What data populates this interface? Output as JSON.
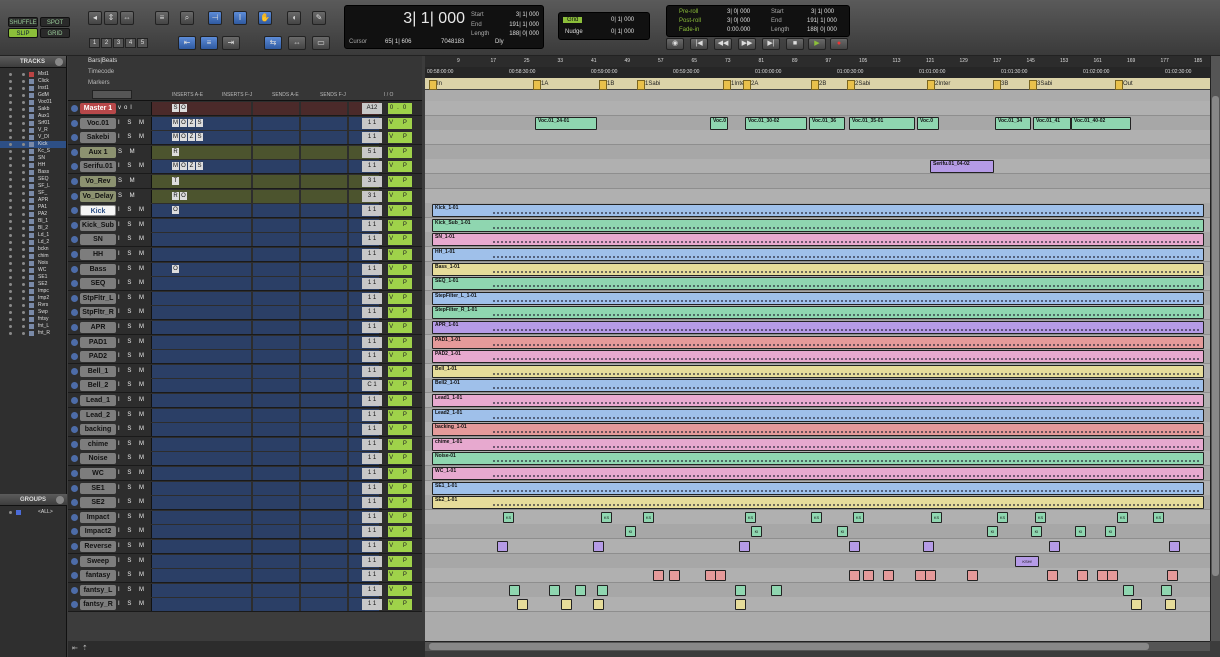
{
  "toolbar": {
    "modes": [
      "SHUFFLE",
      "SPOT",
      "SLIP",
      "GRID"
    ],
    "zoom_presets": [
      "1",
      "2",
      "3",
      "4",
      "5"
    ],
    "counter": {
      "main": "3| 1| 000",
      "cursor_label": "Cursor",
      "cursor_value": "65| 1| 606",
      "samples": "7048183",
      "start_label": "Start",
      "start_value": "3| 1| 000",
      "end_label": "End",
      "end_value": "191| 1| 000",
      "length_label": "Length",
      "length_value": "188| 0| 000",
      "dly_label": "Dly"
    },
    "grid": {
      "label": "Grid",
      "value": "0| 1| 000",
      "nudge_label": "Nudge",
      "nudge_value": "0| 1| 000"
    },
    "preroll": {
      "pre_label": "Pre-roll",
      "pre_value": "3| 0| 000",
      "post_label": "Post-roll",
      "post_value": "3| 0| 000",
      "fade_label": "Fade-in",
      "fade_value": "0:00.000",
      "start_label": "Start",
      "start_value": "3| 1| 000",
      "end_label": "End",
      "end_value": "191| 1| 000",
      "length_label": "Length",
      "length_value": "188| 0| 000"
    },
    "transport": [
      "◉",
      "|◀",
      "◀◀",
      "▶▶",
      "▶|",
      "■",
      "▶",
      "●"
    ]
  },
  "tracks_panel": {
    "title": "TRACKS",
    "items": [
      "Mst1",
      "Click",
      "Inst1",
      "GdM",
      "Voc01",
      "Sakb",
      "Aux1",
      "Srf01",
      "V_R",
      "V_Dl",
      "Kick",
      "Kc_S",
      "SN",
      "HH",
      "Bass",
      "SEQ",
      "SF_L",
      "SF_",
      "APR",
      "PA1",
      "PA2",
      "Bl_1",
      "Bl_2",
      "Ld_1",
      "Ld_2",
      "bckn",
      "chim",
      "Nois",
      "WC",
      "SE1",
      "SE2",
      "Impc",
      "Imp2",
      "Rvrs",
      "Swp",
      "fntsy",
      "fnt_L",
      "fnt_R"
    ],
    "selected": "Kick"
  },
  "groups_panel": {
    "title": "GROUPS",
    "items": [
      "<ALL>"
    ]
  },
  "mix_columns": [
    "INSERTS A-E",
    "INSERTS F-J",
    "SENDS A-E",
    "SENDS F-J",
    "I / O"
  ],
  "tracks": [
    {
      "name": "Master 1",
      "style": "red",
      "ism": "vol",
      "io": "A12",
      "vp": "0.0",
      "slots": [
        "S",
        "O"
      ]
    },
    {
      "name": "Voc.01",
      "ism": "I S M",
      "io": "1 1",
      "vp": "V P",
      "slots": [
        "M",
        "O",
        "Z",
        "S"
      ]
    },
    {
      "name": "Sakebi",
      "ism": "I S M",
      "io": "1 1",
      "vp": "V P",
      "slots": [
        "M",
        "O",
        "Z",
        "S"
      ]
    },
    {
      "name": "Aux 1",
      "style": "olive",
      "ism": "S M",
      "io": "5 1",
      "vp": "V P",
      "slots": [
        "R"
      ]
    },
    {
      "name": "Serifu.01",
      "ism": "I S M",
      "io": "1 1",
      "vp": "V P",
      "slots": [
        "M",
        "O",
        "Z",
        "S"
      ]
    },
    {
      "name": "Vo_Rev",
      "style": "olive",
      "ism": "S M",
      "io": "3 1",
      "vp": "V P",
      "slots": [
        "T"
      ]
    },
    {
      "name": "Vo_Delay",
      "style": "olive",
      "ism": "S M",
      "io": "3 1",
      "vp": "V P",
      "slots": [
        "R",
        "O"
      ]
    },
    {
      "name": "Kick",
      "style": "white",
      "ism": "I S M",
      "io": "1 1",
      "vp": "V P",
      "slots": [
        "O"
      ]
    },
    {
      "name": "Kick_Sub",
      "ism": "I S M",
      "io": "1 1",
      "vp": "V P",
      "slots": []
    },
    {
      "name": "SN",
      "ism": "I S M",
      "io": "1 1",
      "vp": "V P",
      "slots": []
    },
    {
      "name": "HH",
      "ism": "I S M",
      "io": "1 1",
      "vp": "V P",
      "slots": []
    },
    {
      "name": "Bass",
      "ism": "I S M",
      "io": "1 1",
      "vp": "V P",
      "slots": [
        "O"
      ]
    },
    {
      "name": "SEQ",
      "ism": "I S M",
      "io": "1 1",
      "vp": "V P",
      "slots": []
    },
    {
      "name": "StpFltr_L",
      "ism": "I S M",
      "io": "1 1",
      "vp": "V P",
      "slots": []
    },
    {
      "name": "StpFltr_R",
      "ism": "I S M",
      "io": "1 1",
      "vp": "V P",
      "slots": []
    },
    {
      "name": "APR",
      "ism": "I S M",
      "io": "1 1",
      "vp": "V P",
      "slots": []
    },
    {
      "name": "PAD1",
      "ism": "I S M",
      "io": "1 1",
      "vp": "V P",
      "slots": []
    },
    {
      "name": "PAD2",
      "ism": "I S M",
      "io": "1 1",
      "vp": "V P",
      "slots": []
    },
    {
      "name": "Bell_1",
      "ism": "I S M",
      "io": "1 1",
      "vp": "V P",
      "slots": []
    },
    {
      "name": "Bell_2",
      "ism": "I S M",
      "io": "C 1",
      "vp": "V P",
      "slots": []
    },
    {
      "name": "Lead_1",
      "ism": "I S M",
      "io": "1 1",
      "vp": "V P",
      "slots": []
    },
    {
      "name": "Lead_2",
      "ism": "I S M",
      "io": "1 1",
      "vp": "V P",
      "slots": []
    },
    {
      "name": "backing",
      "ism": "I S M",
      "io": "1 1",
      "vp": "V P",
      "slots": []
    },
    {
      "name": "chime",
      "ism": "I S M",
      "io": "1 1",
      "vp": "V P",
      "slots": []
    },
    {
      "name": "Noise",
      "ism": "I S M",
      "io": "1 1",
      "vp": "V P",
      "slots": []
    },
    {
      "name": "WC",
      "ism": "I S M",
      "io": "1 1",
      "vp": "V P",
      "slots": []
    },
    {
      "name": "SE1",
      "ism": "I S M",
      "io": "1 1",
      "vp": "V P",
      "slots": []
    },
    {
      "name": "SE2",
      "ism": "I S M",
      "io": "1 1",
      "vp": "V P",
      "slots": []
    },
    {
      "name": "Impact",
      "ism": "I S M",
      "io": "1 1",
      "vp": "V P",
      "slots": []
    },
    {
      "name": "Impact2",
      "ism": "I S M",
      "io": "1 1",
      "vp": "V P",
      "slots": []
    },
    {
      "name": "Reverse",
      "ism": "I S M",
      "io": "1 1",
      "vp": "V P",
      "slots": []
    },
    {
      "name": "Sweep",
      "ism": "I S M",
      "io": "1 1",
      "vp": "V P",
      "slots": []
    },
    {
      "name": "fantasy",
      "ism": "I S M",
      "io": "1 1",
      "vp": "V P",
      "slots": []
    },
    {
      "name": "fantsy_L",
      "ism": "I S M",
      "io": "1 1",
      "vp": "V P",
      "slots": []
    },
    {
      "name": "fantsy_R",
      "ism": "I S M",
      "io": "1 1",
      "vp": "V P",
      "slots": []
    }
  ],
  "rulers": {
    "bars_label": "Bars|Beats",
    "timecode_label": "Timecode",
    "markers_label": "Markers",
    "bars": [
      "9",
      "17",
      "25",
      "33",
      "41",
      "49",
      "57",
      "65",
      "73",
      "81",
      "89",
      "97",
      "105",
      "113",
      "121",
      "129",
      "137",
      "145",
      "153",
      "161",
      "169",
      "177",
      "185"
    ],
    "timecode": [
      "00:58:00:00",
      "00:58:30:00",
      "00:59:00:00",
      "00:59:30:00",
      "01:00:00:00",
      "01:00:30:00",
      "01:01:00:00",
      "01:01:30:00",
      "01:02:00:00",
      "01:02:30:00"
    ],
    "markers": [
      "In",
      "1A",
      "1B",
      "1Sabi",
      "1Inter",
      "2A",
      "2B",
      "2Sabi",
      "2Inter",
      "3B",
      "3Sabi",
      "Out"
    ]
  },
  "clips": [
    {
      "lane": 1,
      "items": [
        "Voc.01_24-01",
        "Voc.0",
        "Voc.01_30-02",
        "Voc.01_36",
        "Voc.01_35-01",
        "Voc.0",
        "Voc.01_34",
        "Voc.01_41",
        "Voc.01_40-02"
      ]
    },
    {
      "lane": 4,
      "items": [
        "Serifu.01_04-02"
      ]
    },
    {
      "lane": 7,
      "items": [
        "Kick_1-01"
      ]
    },
    {
      "lane": 8,
      "items": [
        "Kick_Sub_1-01"
      ]
    },
    {
      "lane": 9,
      "items": [
        "SN_1-01"
      ]
    },
    {
      "lane": 10,
      "items": [
        "HH_1-01"
      ]
    },
    {
      "lane": 11,
      "items": [
        "Bass_1-01"
      ]
    },
    {
      "lane": 12,
      "items": [
        "SEQ_1-01"
      ]
    },
    {
      "lane": 13,
      "items": [
        "StepFilter_L_1-01"
      ]
    },
    {
      "lane": 14,
      "items": [
        "StepFilter_R_1-01"
      ]
    },
    {
      "lane": 15,
      "items": [
        "APR_1-01"
      ]
    },
    {
      "lane": 16,
      "items": [
        "PAD1_1-01"
      ]
    },
    {
      "lane": 17,
      "items": [
        "PAD2_1-01"
      ]
    },
    {
      "lane": 18,
      "items": [
        "Bell_1-01"
      ]
    },
    {
      "lane": 19,
      "items": [
        "Bell2_1-01"
      ]
    },
    {
      "lane": 20,
      "items": [
        "Lead1_1-01"
      ]
    },
    {
      "lane": 21,
      "items": [
        "Lead2_1-01"
      ]
    },
    {
      "lane": 22,
      "items": [
        "backing_1-01"
      ]
    },
    {
      "lane": 23,
      "items": [
        "chime_1-01"
      ]
    },
    {
      "lane": 24,
      "items": [
        "Noise-01"
      ]
    },
    {
      "lane": 25,
      "items": [
        "WC_1-01"
      ]
    },
    {
      "lane": 26,
      "items": [
        "SE1_1-01"
      ]
    },
    {
      "lane": 27,
      "items": [
        "SE2_1-01"
      ]
    }
  ],
  "midi_labels": {
    "impact": "KS",
    "impact2": "KI",
    "sweep_tag": "KSHf"
  },
  "colors": {
    "accent_blue": "#3d6fc4",
    "green_mode": "#8cbf3a",
    "clip_green": "#8fd6b0",
    "clip_pink": "#e7a9cf",
    "clip_blue": "#9fc0ea",
    "clip_yellow": "#e6dc9a",
    "clip_purple": "#b59be6",
    "clip_red": "#e59a9a"
  }
}
